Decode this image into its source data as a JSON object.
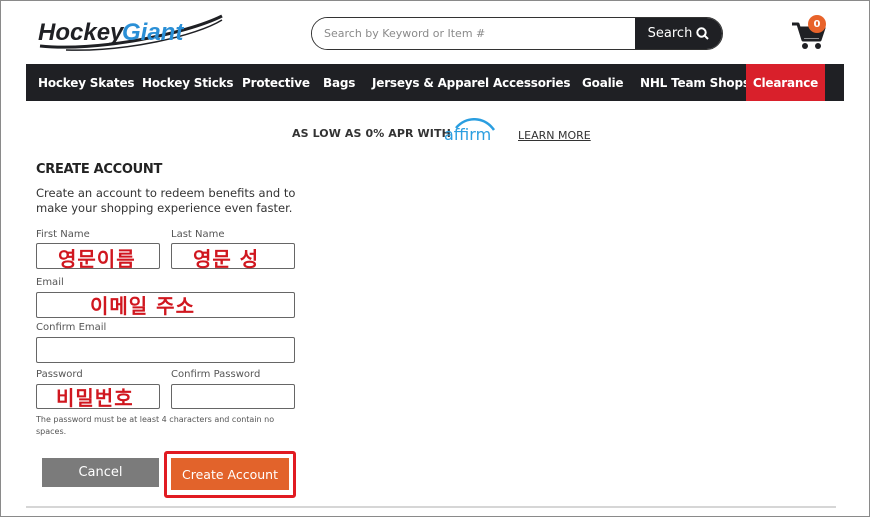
{
  "header": {
    "logo_text_1": "Hockey",
    "logo_text_2": "Giant",
    "search_placeholder": "Search by Keyword or Item #",
    "search_button_label": "Search",
    "cart_count": "0"
  },
  "nav": {
    "items": [
      {
        "label": "Hockey Skates"
      },
      {
        "label": "Hockey Sticks"
      },
      {
        "label": "Protective"
      },
      {
        "label": "Bags"
      },
      {
        "label": "Jerseys & Apparel"
      },
      {
        "label": "Accessories"
      },
      {
        "label": "Goalie"
      },
      {
        "label": "NHL Team Shops"
      },
      {
        "label": "Clearance"
      }
    ]
  },
  "promo": {
    "text": "AS LOW AS 0% APR WITH",
    "brand": "affirm",
    "link": "LEARN MORE"
  },
  "form": {
    "title": "CREATE ACCOUNT",
    "description": "Create an account to redeem benefits and to make your shopping experience even faster.",
    "first_name_label": "First Name",
    "last_name_label": "Last Name",
    "email_label": "Email",
    "confirm_email_label": "Confirm Email",
    "password_label": "Password",
    "confirm_password_label": "Confirm Password",
    "password_hint": "The password must be at least 4 characters and contain no spaces.",
    "cancel_label": "Cancel",
    "create_label": "Create Account"
  },
  "annotations": {
    "first_name": "영문이름",
    "last_name": "영문 성",
    "email": "이메일 주소",
    "password": "비밀번호"
  },
  "colors": {
    "nav_bg": "#1f2024",
    "clearance": "#d9202b",
    "accent": "#e2632b",
    "annotation": "#d0171f"
  }
}
